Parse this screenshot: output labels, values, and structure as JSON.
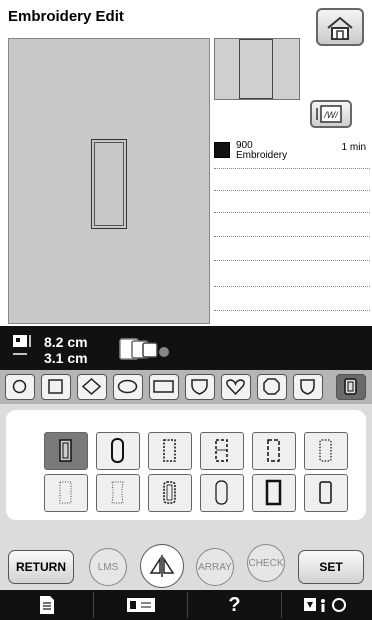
{
  "header": {
    "title": "Embroidery Edit"
  },
  "thread": {
    "code": "900",
    "name": "Embroidery",
    "time": "1 min"
  },
  "size": {
    "width": "8.2 cm",
    "height": "3.1 cm"
  },
  "buttons": {
    "return": "RETURN",
    "lms": "LMS",
    "array": "ARRAY",
    "check": "CHECK",
    "set": "SET"
  },
  "status": {
    "help": "?"
  },
  "icons": [
    "home-icon",
    "scan-icon",
    "size-icon",
    "hoop-icon",
    "shape-circle",
    "shape-square",
    "shape-diamond",
    "shape-ellipse",
    "shape-rectangle",
    "shape-shield",
    "shape-heart",
    "shape-octagon",
    "shape-crest",
    "shape-rounded-rect",
    "mirror-icon",
    "list-icon",
    "sewing-icon",
    "help-icon",
    "settings-icon"
  ]
}
